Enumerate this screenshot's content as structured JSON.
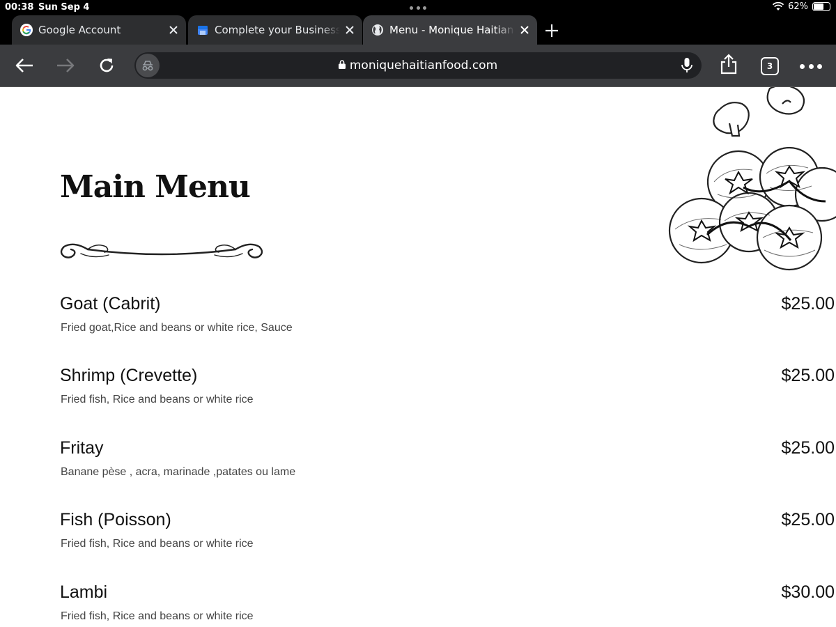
{
  "status_bar": {
    "time": "00:38",
    "date": "Sun Sep 4",
    "battery": "62%",
    "wifi_icon": "wifi-icon",
    "battery_icon": "battery-icon"
  },
  "tabs": [
    {
      "title": "Google Account",
      "favicon": "google-icon",
      "active": false
    },
    {
      "title": "Complete your Business Profile",
      "favicon": "business-profile-icon",
      "active": false
    },
    {
      "title": "Menu - Monique Haitian Food",
      "favicon": "globe-icon",
      "active": true
    }
  ],
  "toolbar": {
    "url": "moniquehaitianfood.com",
    "tab_count": "3",
    "icons": [
      "back-icon",
      "forward-icon",
      "reload-icon",
      "incognito-icon",
      "lock-icon",
      "mic-icon",
      "share-icon",
      "tab-switcher-icon",
      "more-icon"
    ]
  },
  "page": {
    "heading": "Main Menu",
    "items": [
      {
        "name": "Goat (Cabrit)",
        "description": "Fried goat,Rice and beans or white rice, Sauce",
        "price": "$25.00"
      },
      {
        "name": "Shrimp (Crevette)",
        "description": "Fried fish, Rice and beans or white rice",
        "price": "$25.00"
      },
      {
        "name": "Fritay",
        "description": "Banane pèse , acra, marinade ,patates ou lame",
        "price": "$25.00"
      },
      {
        "name": "Fish (Poisson)",
        "description": "Fried fish, Rice and beans or white rice",
        "price": "$25.00"
      },
      {
        "name": "Lambi",
        "description": "Fried fish, Rice and beans or white rice",
        "price": "$30.00"
      }
    ]
  },
  "colors": {
    "chrome_dark": "#3b3c3f",
    "tab_inactive": "#2d2e30",
    "omnibox": "#202124",
    "page_bg": "#ffffff",
    "text": "#111111"
  }
}
